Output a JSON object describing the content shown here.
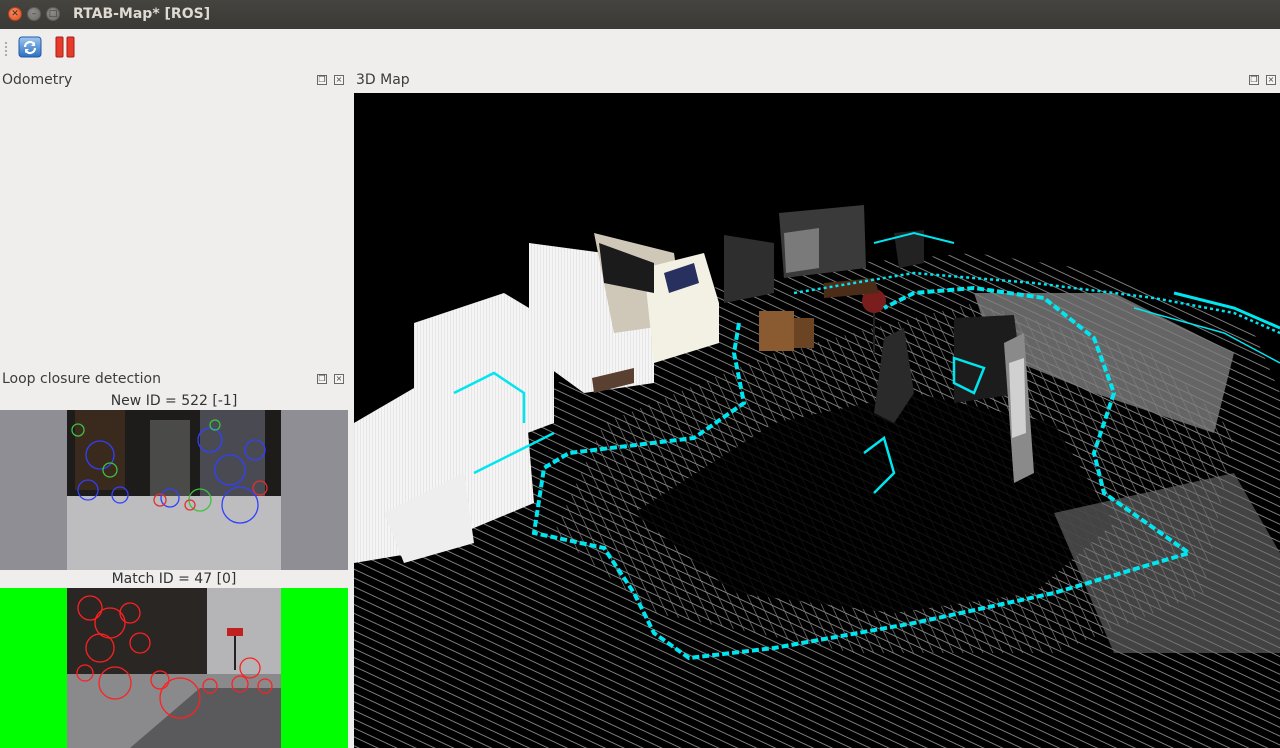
{
  "window": {
    "title": "RTAB-Map* [ROS]"
  },
  "toolbar": {
    "buttons": [
      {
        "name": "refresh",
        "icon": "refresh-icon"
      },
      {
        "name": "pause",
        "icon": "pause-icon"
      }
    ]
  },
  "docks": {
    "odometry": {
      "title": "Odometry"
    },
    "map3d": {
      "title": "3D Map"
    },
    "loop_closure": {
      "title": "Loop closure detection",
      "new_label": "New ID = 522 [-1]",
      "match_label": "Match ID = 47 [0]"
    }
  },
  "colors": {
    "titlebar": "#3c3b37",
    "window_bg": "#efeeec",
    "trajectory": "#00e6f0",
    "match_highlight": "#00ff00",
    "new_features": "#3040ff",
    "match_features": "#ff2020"
  }
}
